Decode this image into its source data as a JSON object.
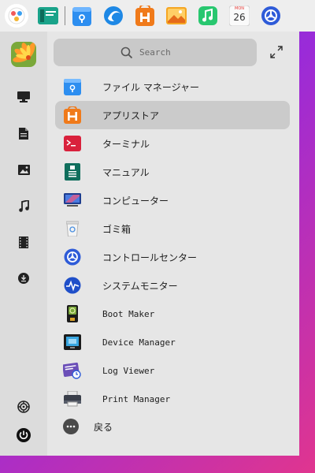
{
  "dock": {
    "items": [
      {
        "name": "launcher",
        "icon": "launcher-icon"
      },
      {
        "name": "multitasking-view",
        "icon": "multitask-icon"
      },
      {
        "name": "file-manager",
        "icon": "folder-icon"
      },
      {
        "name": "browser",
        "icon": "browser-icon"
      },
      {
        "name": "app-store",
        "icon": "store-icon"
      },
      {
        "name": "image-viewer",
        "icon": "image-icon"
      },
      {
        "name": "music",
        "icon": "music-icon"
      },
      {
        "name": "calendar",
        "icon": "calendar-icon",
        "weekday": "MON",
        "day": "26"
      },
      {
        "name": "control-center",
        "icon": "settings-gear-icon"
      }
    ]
  },
  "sidebar": {
    "items": [
      {
        "name": "computer",
        "icon": "monitor-icon"
      },
      {
        "name": "documents",
        "icon": "document-icon"
      },
      {
        "name": "pictures",
        "icon": "picture-icon"
      },
      {
        "name": "music",
        "icon": "music-note-icon"
      },
      {
        "name": "videos",
        "icon": "film-icon"
      },
      {
        "name": "downloads",
        "icon": "download-icon"
      }
    ],
    "bottom": [
      {
        "name": "settings",
        "icon": "gear-icon"
      },
      {
        "name": "power",
        "icon": "power-icon"
      }
    ]
  },
  "search": {
    "placeholder": "Search"
  },
  "apps": [
    {
      "label": "ファイル マネージャー",
      "icon": "file-manager-icon"
    },
    {
      "label": "アプリストア",
      "icon": "app-store-icon",
      "selected": true
    },
    {
      "label": "ターミナル",
      "icon": "terminal-icon"
    },
    {
      "label": "マニュアル",
      "icon": "manual-icon"
    },
    {
      "label": "コンピューター",
      "icon": "computer-icon"
    },
    {
      "label": "ゴミ箱",
      "icon": "trash-icon"
    },
    {
      "label": "コントロールセンター",
      "icon": "control-center-icon"
    },
    {
      "label": "システムモニター",
      "icon": "system-monitor-icon"
    },
    {
      "label": "Boot Maker",
      "icon": "boot-maker-icon"
    },
    {
      "label": "Device Manager",
      "icon": "device-manager-icon"
    },
    {
      "label": "Log Viewer",
      "icon": "log-viewer-icon"
    },
    {
      "label": "Print Manager",
      "icon": "print-manager-icon"
    }
  ],
  "back": {
    "label": "戻る"
  },
  "colors": {
    "accent_blue": "#2f7de1",
    "selected_row": "#cbcbcb",
    "panel": "#e6e6e6",
    "rail": "#dcdcdc"
  }
}
